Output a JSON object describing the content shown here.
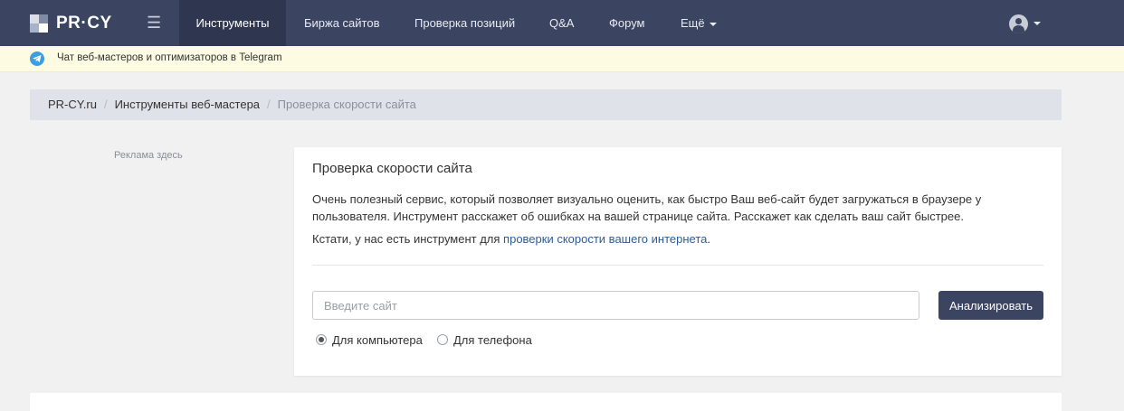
{
  "colors": {
    "nav_bg": "#3b4461",
    "nav_active_bg": "#2f3650",
    "telegram_bar_bg": "#fdfbe2",
    "link": "#2c5d9a"
  },
  "header": {
    "logo_text": "PR·CY",
    "logo_icon": "pr-cy-logo-icon",
    "menu_icon": "hamburger-icon",
    "nav": [
      {
        "label": "Инструменты",
        "active": true
      },
      {
        "label": "Биржа сайтов",
        "active": false
      },
      {
        "label": "Проверка позиций",
        "active": false
      },
      {
        "label": "Q&A",
        "active": false
      },
      {
        "label": "Форум",
        "active": false
      },
      {
        "label": "Ещё",
        "active": false,
        "dropdown": true
      }
    ],
    "user_icon": "user-avatar-icon"
  },
  "telegram_bar": {
    "icon": "telegram-icon",
    "text": "Чат веб-мастеров и оптимизаторов в Telegram"
  },
  "breadcrumb": {
    "items": [
      "PR-CY.ru",
      "Инструменты веб-мастера",
      "Проверка скорости сайта"
    ],
    "separator": "/"
  },
  "sidebar": {
    "ad_text": "Реклама здесь"
  },
  "main": {
    "title": "Проверка скорости сайта",
    "description": "Очень полезный сервис, который позволяет визуально оценить, как быстро Ваш веб-сайт будет загружаться в браузере у пользователя. Инструмент расскажет об ошибках на вашей странице сайта. Расскажет как сделать ваш сайт быстрее.",
    "note_prefix": "Кстати, у нас есть инструмент для ",
    "note_link": "проверки скорости вашего интернета",
    "note_suffix": ".",
    "input_placeholder": "Введите сайт",
    "input_value": "",
    "analyze_button": "Анализировать",
    "device_options": [
      {
        "label": "Для компьютера",
        "selected": true
      },
      {
        "label": "Для телефона",
        "selected": false
      }
    ]
  }
}
